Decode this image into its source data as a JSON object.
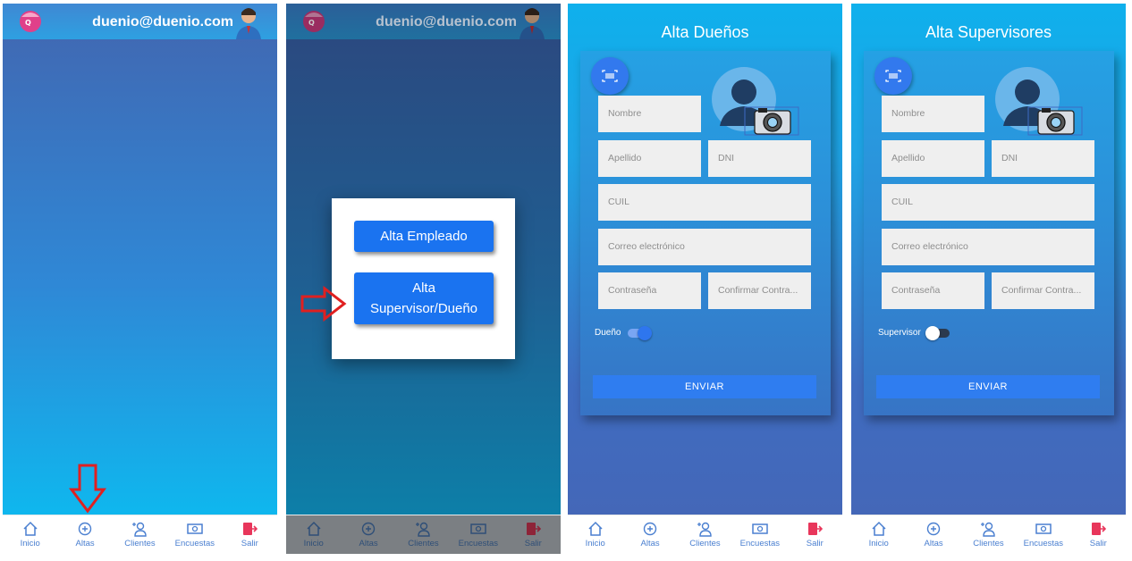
{
  "colors": {
    "primary_blue": "#1a73f0",
    "nav_blue": "#4a7fd0",
    "red_arrow": "#e02020"
  },
  "user": {
    "email": "duenio@duenio.com"
  },
  "nav": {
    "items": [
      {
        "label": "Inicio",
        "icon": "home-icon"
      },
      {
        "label": "Altas",
        "icon": "plus-circle-icon"
      },
      {
        "label": "Clientes",
        "icon": "add-user-icon"
      },
      {
        "label": "Encuestas",
        "icon": "money-icon"
      },
      {
        "label": "Salir",
        "icon": "logout-icon"
      }
    ]
  },
  "modal": {
    "alta_empleado": "Alta Empleado",
    "alta_supervisor_line1": "Alta",
    "alta_supervisor_line2": "Supervisor/Dueño"
  },
  "form_duenos": {
    "title": "Alta Dueños",
    "nombre": "Nombre",
    "apellido": "Apellido",
    "dni": "DNI",
    "cuil": "CUIL",
    "correo": "Correo electrónico",
    "contrasena": "Contraseña",
    "confirmar": "Confirmar Contra...",
    "toggle_label": "Dueño",
    "toggle_on": true,
    "enviar": "ENVIAR"
  },
  "form_supervisores": {
    "title": "Alta Supervisores",
    "nombre": "Nombre",
    "apellido": "Apellido",
    "dni": "DNI",
    "cuil": "CUIL",
    "correo": "Correo electrónico",
    "contrasena": "Contraseña",
    "confirmar": "Confirmar Contra...",
    "toggle_label": "Supervisor",
    "toggle_on": false,
    "enviar": "ENVIAR"
  }
}
